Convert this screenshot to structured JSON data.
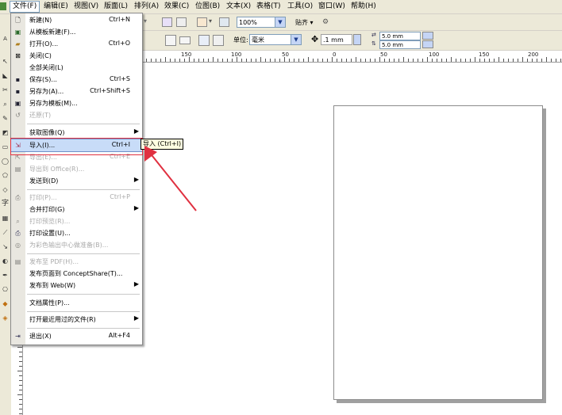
{
  "menubar": {
    "items": [
      {
        "label": "文件(F)",
        "active": true
      },
      {
        "label": "编辑(E)"
      },
      {
        "label": "视图(V)"
      },
      {
        "label": "版面(L)"
      },
      {
        "label": "排列(A)"
      },
      {
        "label": "效果(C)"
      },
      {
        "label": "位图(B)"
      },
      {
        "label": "文本(X)"
      },
      {
        "label": "表格(T)"
      },
      {
        "label": "工具(O)"
      },
      {
        "label": "窗口(W)"
      },
      {
        "label": "帮助(H)"
      }
    ]
  },
  "toolbar": {
    "zoom_value": "100%",
    "snap_label": "贴齐",
    "unit_label": "单位:",
    "unit_value": "毫米",
    "nudge_value": ".1 mm",
    "dup_x": "5.0 mm",
    "dup_y": "5.0 mm"
  },
  "ruler": {
    "h_labels": [
      "150",
      "100",
      "50",
      "0",
      "50",
      "100",
      "150",
      "200"
    ]
  },
  "file_menu": {
    "items": [
      {
        "label": "新建(N)",
        "shortcut": "Ctrl+N",
        "icon": "new-document-icon"
      },
      {
        "label": "从模板新建(F)...",
        "shortcut": "",
        "icon": "template-icon"
      },
      {
        "label": "打开(O)...",
        "shortcut": "Ctrl+O",
        "icon": "open-folder-icon"
      },
      {
        "label": "关闭(C)",
        "shortcut": "",
        "icon": "close-document-icon"
      },
      {
        "label": "全部关闭(L)",
        "shortcut": "",
        "icon": ""
      },
      {
        "label": "保存(S)...",
        "shortcut": "Ctrl+S",
        "icon": "save-icon"
      },
      {
        "label": "另存为(A)...",
        "shortcut": "Ctrl+Shift+S",
        "icon": "save-as-icon"
      },
      {
        "label": "另存为模板(M)...",
        "shortcut": "",
        "icon": "save-template-icon"
      },
      {
        "label": "还原(T)",
        "shortcut": "",
        "icon": "revert-icon",
        "disabled": true
      },
      {
        "label": "获取图像(Q)",
        "shortcut": "",
        "submenu": true
      },
      {
        "label": "导入(I)...",
        "shortcut": "Ctrl+I",
        "icon": "import-icon",
        "highlighted": true
      },
      {
        "label": "导出(E)...",
        "shortcut": "Ctrl+E",
        "icon": "export-icon",
        "disabled": true
      },
      {
        "label": "导出到 Office(R)...",
        "shortcut": "",
        "icon": "export-office-icon",
        "disabled": true
      },
      {
        "label": "发送到(D)",
        "shortcut": "",
        "submenu": true
      },
      {
        "label": "打印(P)...",
        "shortcut": "Ctrl+P",
        "icon": "print-icon",
        "disabled": true
      },
      {
        "label": "合并打印(G)",
        "shortcut": "",
        "submenu": true
      },
      {
        "label": "打印预览(R)...",
        "shortcut": "",
        "icon": "print-preview-icon",
        "disabled": true
      },
      {
        "label": "打印设置(U)...",
        "shortcut": "",
        "icon": "print-setup-icon"
      },
      {
        "label": "为彩色输出中心做准备(B)...",
        "shortcut": "",
        "icon": "prepare-output-icon",
        "disabled": true
      },
      {
        "label": "发布至 PDF(H)...",
        "shortcut": "",
        "icon": "pdf-icon",
        "disabled": true
      },
      {
        "label": "发布页面到 ConceptShare(T)...",
        "shortcut": ""
      },
      {
        "label": "发布到 Web(W)",
        "shortcut": "",
        "submenu": true
      },
      {
        "label": "文档属性(P)...",
        "shortcut": ""
      },
      {
        "label": "打开最近用过的文件(R)",
        "shortcut": "",
        "submenu": true
      },
      {
        "label": "退出(X)",
        "shortcut": "Alt+F4",
        "icon": "exit-icon"
      }
    ]
  },
  "tooltip": {
    "text": "导入 (Ctrl+I)"
  },
  "colors": {
    "annotation_red": "#e03040",
    "highlight": "#c8dcf8"
  }
}
